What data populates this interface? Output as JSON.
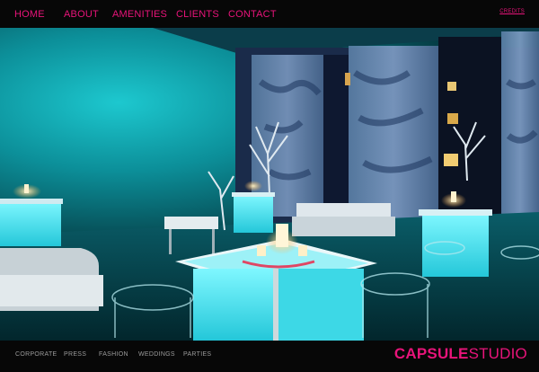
{
  "nav": {
    "items": [
      {
        "label": "HOME"
      },
      {
        "label": "ABOUT"
      },
      {
        "label": "AMENITIES"
      },
      {
        "label": "CLIENTS"
      },
      {
        "label": "CONTACT"
      }
    ],
    "credits": "CREDITS"
  },
  "hero": {
    "tone": "#0fb8c4"
  },
  "footer": {
    "links": [
      {
        "label": "CORPORATE"
      },
      {
        "label": "PRESS"
      },
      {
        "label": "FASHION"
      },
      {
        "label": "WEDDINGS"
      },
      {
        "label": "PARTIES"
      }
    ],
    "brand_bold": "CAPSULE",
    "brand_regular": "STUDIO",
    "accent_color": "#e8147a"
  }
}
